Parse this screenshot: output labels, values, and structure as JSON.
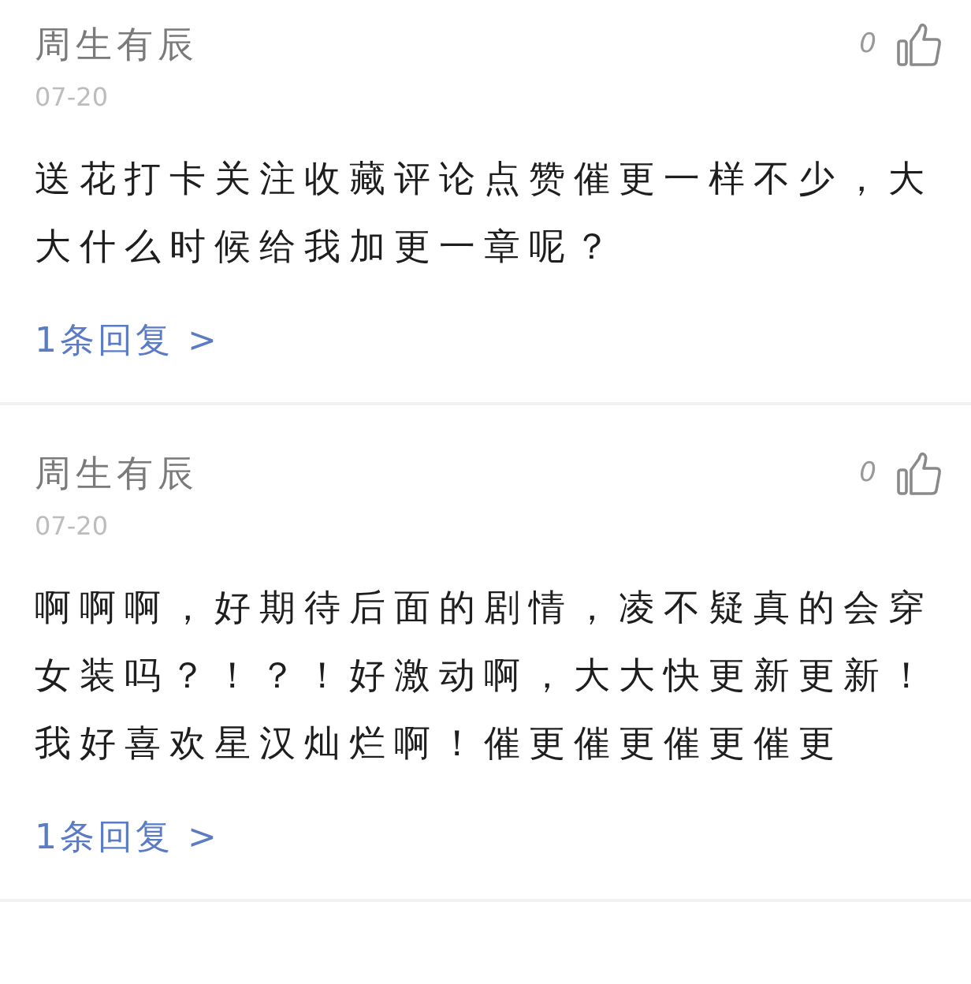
{
  "comments": [
    {
      "author": "周生有辰",
      "date": "07-20",
      "likes": "0",
      "text": "送花打卡关注收藏评论点赞催更一样不少，大大什么时候给我加更一章呢？",
      "replies": "1条回复 >"
    },
    {
      "author": "周生有辰",
      "date": "07-20",
      "likes": "0",
      "text": "啊啊啊，好期待后面的剧情，凌不疑真的会穿女装吗？！？！好激动啊，大大快更新更新！我好喜欢星汉灿烂啊！催更催更催更催更",
      "replies": "1条回复 >"
    }
  ]
}
